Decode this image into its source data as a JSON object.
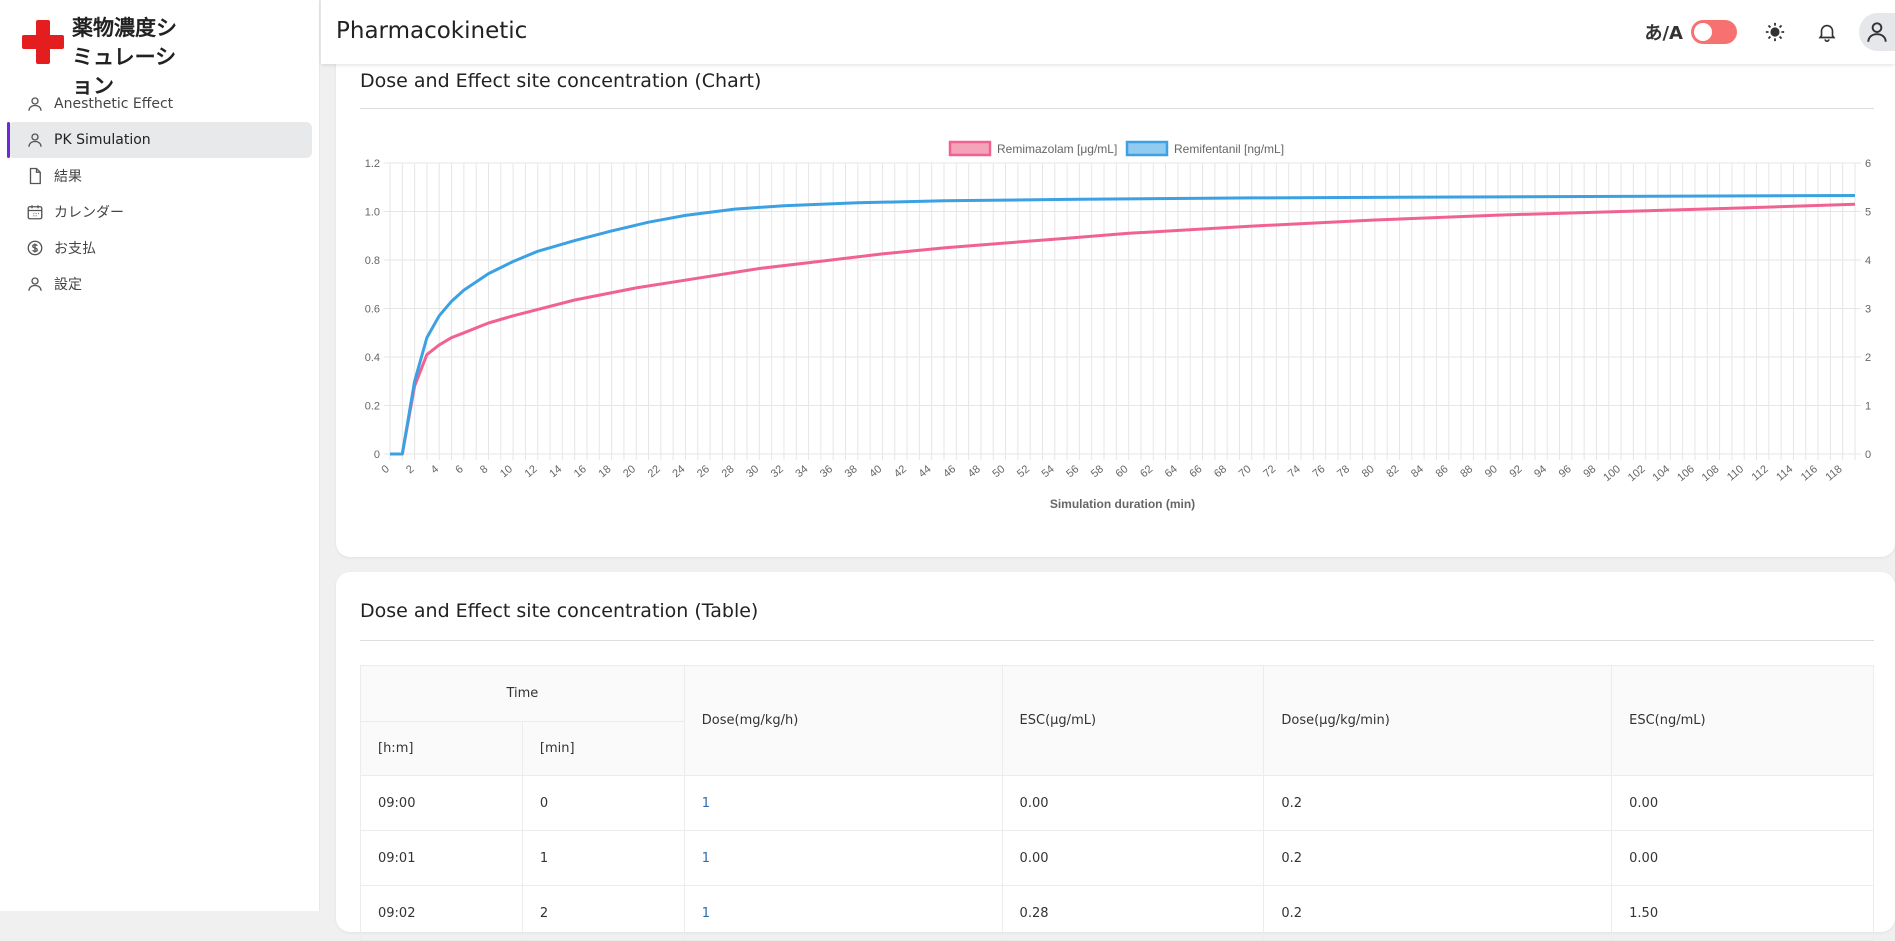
{
  "app": {
    "title": "薬物濃度シミュレーション"
  },
  "sidebar": {
    "items": [
      {
        "label": "Anesthetic Effect",
        "icon": "user-icon",
        "active": false
      },
      {
        "label": "PK Simulation",
        "icon": "user-icon",
        "active": true
      },
      {
        "label": "結果",
        "icon": "file-icon",
        "active": false
      },
      {
        "label": "カレンダー",
        "icon": "calendar-icon",
        "active": false
      },
      {
        "label": "お支払",
        "icon": "dollar-icon",
        "active": false
      },
      {
        "label": "設定",
        "icon": "user-icon",
        "active": false
      }
    ]
  },
  "header": {
    "title": "Pharmacokinetic",
    "lang_label": "あ/A",
    "toggle_color": "#f87171"
  },
  "chart_card": {
    "title": "Dose and Effect site concentration (Chart)"
  },
  "chart_data": {
    "type": "line",
    "xlabel": "Simulation duration (min)",
    "x_tick_step": 2,
    "xlim": [
      0,
      119
    ],
    "y_left": {
      "ylim": [
        0,
        1.2
      ],
      "ticks": [
        "0",
        "0.2",
        "0.4",
        "0.6",
        "0.8",
        "1.0",
        "1.2"
      ]
    },
    "y_right": {
      "ylim": [
        0,
        6
      ],
      "ticks": [
        "0",
        "1",
        "2",
        "3",
        "4",
        "5",
        "6"
      ]
    },
    "grid": true,
    "legend_position": "top",
    "series": [
      {
        "name": "Remimazolam [μg/mL]",
        "axis": "left",
        "color": "#f06292",
        "fill": "#f5a3b9",
        "points": [
          [
            0,
            0
          ],
          [
            1,
            0
          ],
          [
            2,
            0.28
          ],
          [
            3,
            0.41
          ],
          [
            4,
            0.45
          ],
          [
            5,
            0.48
          ],
          [
            6,
            0.5
          ],
          [
            8,
            0.54
          ],
          [
            10,
            0.57
          ],
          [
            15,
            0.635
          ],
          [
            20,
            0.685
          ],
          [
            25,
            0.725
          ],
          [
            30,
            0.765
          ],
          [
            35,
            0.795
          ],
          [
            40,
            0.825
          ],
          [
            45,
            0.85
          ],
          [
            50,
            0.87
          ],
          [
            55,
            0.89
          ],
          [
            60,
            0.91
          ],
          [
            70,
            0.94
          ],
          [
            80,
            0.965
          ],
          [
            90,
            0.985
          ],
          [
            100,
            1.0
          ],
          [
            110,
            1.015
          ],
          [
            119,
            1.03
          ]
        ]
      },
      {
        "name": "Remifentanil [ng/mL]",
        "axis": "right",
        "color": "#3ba1e3",
        "fill": "#91cbf0",
        "points": [
          [
            0,
            0
          ],
          [
            1,
            0
          ],
          [
            2,
            1.5
          ],
          [
            3,
            2.4
          ],
          [
            4,
            2.85
          ],
          [
            5,
            3.15
          ],
          [
            6,
            3.38
          ],
          [
            8,
            3.72
          ],
          [
            10,
            3.97
          ],
          [
            12,
            4.18
          ],
          [
            15,
            4.4
          ],
          [
            18,
            4.6
          ],
          [
            21,
            4.78
          ],
          [
            24,
            4.92
          ],
          [
            28,
            5.05
          ],
          [
            32,
            5.12
          ],
          [
            38,
            5.18
          ],
          [
            45,
            5.22
          ],
          [
            55,
            5.25
          ],
          [
            70,
            5.28
          ],
          [
            90,
            5.3
          ],
          [
            119,
            5.33
          ]
        ]
      }
    ]
  },
  "table_card": {
    "title": "Dose and Effect site concentration (Table)",
    "headers": {
      "time": "Time",
      "hm": "[h:m]",
      "min": "[min]",
      "dose1": "Dose(mg/kg/h)",
      "esc1": "ESC(μg/mL)",
      "dose2": "Dose(μg/kg/min)",
      "esc2": "ESC(ng/mL)"
    },
    "rows": [
      {
        "hm": "09:00",
        "min": "0",
        "dose1": "1",
        "esc1": "0.00",
        "dose2": "0.2",
        "esc2": "0.00"
      },
      {
        "hm": "09:01",
        "min": "1",
        "dose1": "1",
        "esc1": "0.00",
        "dose2": "0.2",
        "esc2": "0.00"
      },
      {
        "hm": "09:02",
        "min": "2",
        "dose1": "1",
        "esc1": "0.28",
        "dose2": "0.2",
        "esc2": "1.50"
      }
    ]
  }
}
